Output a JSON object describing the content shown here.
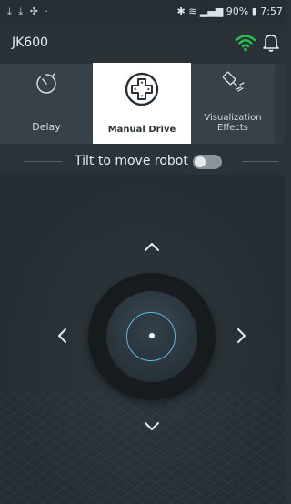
{
  "status_bar": {
    "left_icons": "⤓ ⤓ ✣ ·",
    "right_text": "✱ ≋ ▂▄▆ 90% ▮ 7:57",
    "battery": "90%",
    "time": "7:57"
  },
  "app_bar": {
    "title": "JK600",
    "icons": [
      "wifi-icon",
      "bell-icon"
    ],
    "wifi_color": "#25c24a"
  },
  "modes": [
    {
      "label": "Delay",
      "icon": "timer-icon",
      "selected": false
    },
    {
      "label": "Manual Drive",
      "icon": "gamepad-icon",
      "selected": true
    },
    {
      "label": "Visualization\nEffects",
      "icon": "satellite-icon",
      "selected": false
    }
  ],
  "tilt": {
    "label": "Tilt to move robot",
    "toggle_on": false
  },
  "joystick": {
    "arrows": [
      "up-arrow-icon",
      "down-arrow-icon",
      "left-arrow-icon",
      "right-arrow-icon"
    ],
    "accent_color": "#5fb6de"
  }
}
